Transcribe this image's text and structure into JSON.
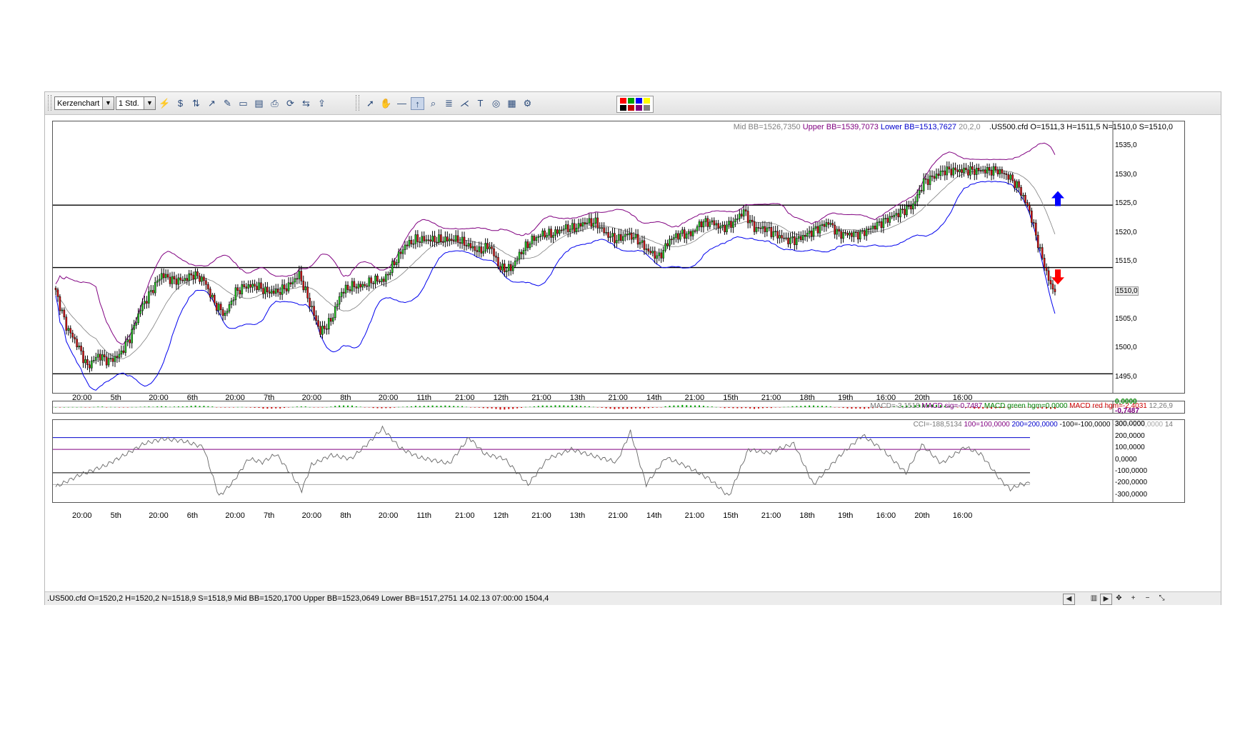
{
  "toolbar": {
    "chart_type": "Kerzenchart",
    "timeframe": "1 Std.",
    "icons_left": [
      "candle-chart-icon",
      "indicator-icon",
      "tools-icon",
      "line-chart-icon",
      "edit-icon",
      "window-icon",
      "page-icon",
      "print-icon",
      "refresh-icon",
      "compare-icon",
      "export-icon"
    ],
    "icons_right": [
      "cursor-arrow-icon",
      "hand-icon",
      "line-tool-icon",
      "arrow-tool-icon",
      "zoom-icon",
      "fibonacci-icon",
      "gann-icon",
      "text-tool-icon",
      "cycle-icon",
      "calculator-icon",
      "settings-icon"
    ],
    "text_tool_glyph": "T",
    "palette": [
      "#ff0000",
      "#00a000",
      "#0000ff",
      "#ffff00",
      "#000000",
      "#c00000",
      "#800080",
      "#808080"
    ]
  },
  "main_pane": {
    "bb_mid": "Mid BB=1526,7350",
    "bb_upper": "Upper BB=1539,7073",
    "bb_lower": "Lower BB=1513,7627",
    "bb_params": "20,2,0",
    "ohlc": ".US500.cfd O=1511,3 H=1511,5 N=1510,0 S=1510,0",
    "price_label": "1510,0",
    "colors": {
      "up": "#22cc22",
      "down": "#dd1111",
      "upper_bb": "#800080",
      "lower_bb": "#0000ee",
      "mid_bb": "#808080"
    }
  },
  "x_axis_labels": [
    "20:00",
    "5th",
    "20:00",
    "6th",
    "20:00",
    "7th",
    "20:00",
    "8th",
    "20:00",
    "11th",
    "21:00",
    "12th",
    "21:00",
    "13th",
    "21:00",
    "14th",
    "21:00",
    "15th",
    "21:00",
    "18th",
    "19th",
    "16:00",
    "20th",
    "16:00"
  ],
  "macd_pane": {
    "label_macd": "MACD=-3,1518",
    "label_sig": "MACD sig=-0,7487",
    "label_green": "MACD green hgm=0,0000",
    "label_red": "MACD red hgm=-2,4031",
    "params": "12,26,9",
    "ytick_1": "0,0000",
    "ytick_2": "-0,7487"
  },
  "cci_pane": {
    "label_cci": "CCI=-188,5134",
    "label_100": "100=100,0000",
    "label_200": "200=200,0000",
    "label_m100": "-100=-100,0000",
    "label_m200": "-200=-200,0000",
    "period": "14",
    "yticks": [
      "300,0000",
      "200,0000",
      "100,0000",
      "0,0000",
      "-100,0000",
      "-200,0000",
      "-300,0000"
    ]
  },
  "statusbar": {
    "info": ".US500.cfd O=1520,2 H=1520,2 N=1518,9 S=1518,9  Mid BB=1520,1700 Upper BB=1523,0649 Lower BB=1517,2751  14.02.13 07:00:00 1504,4",
    "plus": "+",
    "minus": "−"
  },
  "chart_data": [
    {
      "type": "candlestick",
      "y_axis_ticks": [
        "1535,0",
        "1530,0",
        "1525,0",
        "1520,0",
        "1515,0",
        "1510,0",
        "1505,0",
        "1500,0",
        "1495,0"
      ],
      "ylim": [
        1492.5,
        1539.5
      ],
      "horizontal_lines": [
        1525.0,
        1514.2,
        1495.8
      ],
      "close_anchors": [
        [
          0,
          1510
        ],
        [
          5,
          1504
        ],
        [
          10,
          1501
        ],
        [
          15,
          1497
        ],
        [
          20,
          1499
        ],
        [
          25,
          1498
        ],
        [
          30,
          1499
        ],
        [
          35,
          1502
        ],
        [
          40,
          1507
        ],
        [
          45,
          1510
        ],
        [
          50,
          1513
        ],
        [
          55,
          1512
        ],
        [
          60,
          1512
        ],
        [
          65,
          1513
        ],
        [
          70,
          1512
        ],
        [
          75,
          1508
        ],
        [
          80,
          1506
        ],
        [
          85,
          1510
        ],
        [
          90,
          1511
        ],
        [
          95,
          1511
        ],
        [
          100,
          1510
        ],
        [
          105,
          1510
        ],
        [
          110,
          1511
        ],
        [
          115,
          1513
        ],
        [
          120,
          1508
        ],
        [
          125,
          1503
        ],
        [
          130,
          1505
        ],
        [
          135,
          1510
        ],
        [
          140,
          1511
        ],
        [
          145,
          1511
        ],
        [
          150,
          1512
        ],
        [
          155,
          1512
        ],
        [
          160,
          1515
        ],
        [
          165,
          1518
        ],
        [
          170,
          1519
        ],
        [
          175,
          1519
        ],
        [
          180,
          1519
        ],
        [
          185,
          1519
        ],
        [
          190,
          1519
        ],
        [
          195,
          1518
        ],
        [
          200,
          1517
        ],
        [
          205,
          1518
        ],
        [
          210,
          1514
        ],
        [
          215,
          1514
        ],
        [
          220,
          1517
        ],
        [
          225,
          1519
        ],
        [
          230,
          1520
        ],
        [
          235,
          1520
        ],
        [
          240,
          1521
        ],
        [
          245,
          1521
        ],
        [
          250,
          1522
        ],
        [
          255,
          1522
        ],
        [
          260,
          1520
        ],
        [
          265,
          1519
        ],
        [
          270,
          1520
        ],
        [
          275,
          1519
        ],
        [
          280,
          1517
        ],
        [
          285,
          1516
        ],
        [
          290,
          1519
        ],
        [
          295,
          1520
        ],
        [
          300,
          1520
        ],
        [
          305,
          1522
        ],
        [
          310,
          1522
        ],
        [
          315,
          1521
        ],
        [
          320,
          1522
        ],
        [
          325,
          1524
        ],
        [
          330,
          1521
        ],
        [
          335,
          1521
        ],
        [
          340,
          1520
        ],
        [
          345,
          1519
        ],
        [
          350,
          1519
        ],
        [
          355,
          1520
        ],
        [
          360,
          1521
        ],
        [
          365,
          1522
        ],
        [
          370,
          1520
        ],
        [
          375,
          1520
        ],
        [
          380,
          1520
        ],
        [
          385,
          1521
        ],
        [
          390,
          1522
        ],
        [
          395,
          1523
        ],
        [
          400,
          1524
        ],
        [
          405,
          1525
        ],
        [
          410,
          1529
        ],
        [
          415,
          1530
        ],
        [
          420,
          1531
        ],
        [
          425,
          1531
        ],
        [
          430,
          1531
        ],
        [
          435,
          1531
        ],
        [
          440,
          1531
        ],
        [
          445,
          1531
        ],
        [
          450,
          1530
        ],
        [
          455,
          1528
        ],
        [
          460,
          1524
        ],
        [
          465,
          1517
        ],
        [
          470,
          1511
        ],
        [
          472,
          1510
        ]
      ],
      "series": [
        {
          "name": "Upper BB",
          "values_note": "Upper Bollinger band"
        },
        {
          "name": "Mid BB",
          "values_note": "Middle Bollinger band"
        },
        {
          "name": "Lower BB",
          "values_note": "Lower Bollinger band"
        }
      ],
      "last_values": {
        "mid_bb": 1526.735,
        "upper_bb": 1539.7073,
        "lower_bb": 1513.7627,
        "close": 1510.0
      },
      "arrows": [
        {
          "direction": "up",
          "price": 1526.2,
          "color": "#0000ff"
        },
        {
          "direction": "down",
          "price": 1512.5,
          "color": "#ff0000"
        }
      ]
    },
    {
      "type": "histogram",
      "last_values": {
        "macd": -3.1518,
        "signal": -0.7487,
        "green_hgm": 0.0,
        "red_hgm": -2.4031
      }
    },
    {
      "type": "line",
      "ylim": [
        -350,
        350
      ],
      "levels": [
        200,
        100,
        -100,
        -200
      ],
      "cci_anchors": [
        [
          0,
          -220
        ],
        [
          12,
          -120
        ],
        [
          25,
          -40
        ],
        [
          38,
          80
        ],
        [
          45,
          150
        ],
        [
          55,
          190
        ],
        [
          65,
          170
        ],
        [
          75,
          120
        ],
        [
          83,
          -300
        ],
        [
          90,
          -180
        ],
        [
          98,
          20
        ],
        [
          105,
          -10
        ],
        [
          112,
          60
        ],
        [
          120,
          -120
        ],
        [
          125,
          -250
        ],
        [
          130,
          -30
        ],
        [
          140,
          50
        ],
        [
          150,
          20
        ],
        [
          158,
          140
        ],
        [
          166,
          280
        ],
        [
          175,
          110
        ],
        [
          185,
          30
        ],
        [
          200,
          -20
        ],
        [
          210,
          200
        ],
        [
          218,
          60
        ],
        [
          228,
          20
        ],
        [
          240,
          -200
        ],
        [
          250,
          20
        ],
        [
          262,
          100
        ],
        [
          272,
          50
        ],
        [
          285,
          -10
        ],
        [
          292,
          250
        ],
        [
          300,
          -200
        ],
        [
          310,
          30
        ],
        [
          320,
          -40
        ],
        [
          332,
          -150
        ],
        [
          342,
          -300
        ],
        [
          352,
          100
        ],
        [
          362,
          70
        ],
        [
          375,
          150
        ],
        [
          385,
          -200
        ],
        [
          398,
          40
        ],
        [
          410,
          220
        ],
        [
          420,
          100
        ],
        [
          432,
          -100
        ],
        [
          440,
          140
        ],
        [
          450,
          -20
        ],
        [
          462,
          120
        ],
        [
          470,
          60
        ],
        [
          480,
          -160
        ],
        [
          485,
          -240
        ],
        [
          490,
          -200
        ],
        [
          495,
          -188
        ]
      ],
      "last_value": -188.5134
    }
  ]
}
